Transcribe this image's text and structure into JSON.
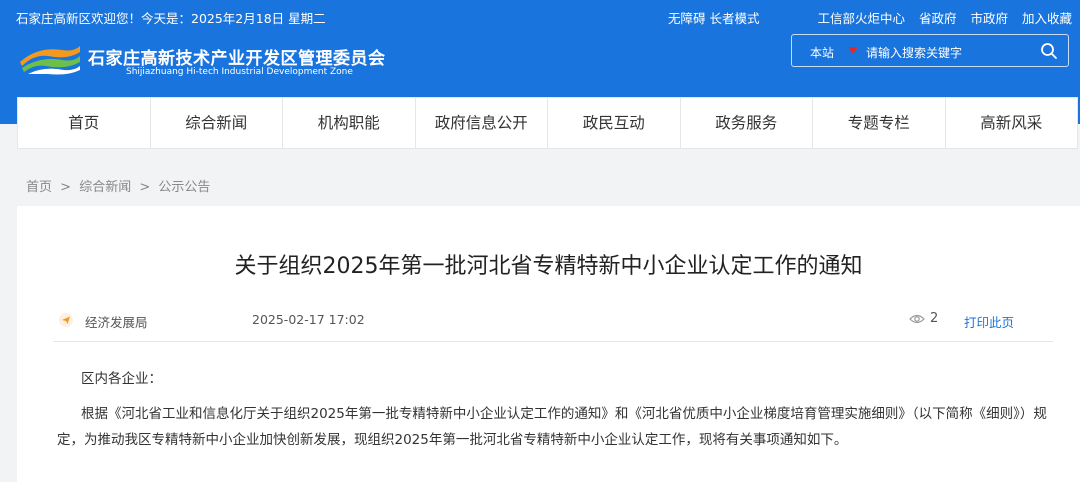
{
  "topbar": {
    "welcome": "石家庄高新区欢迎您！今天是：2025年2月18日 星期二",
    "accessibility": "无障碍 长者模式",
    "links": [
      "工信部火炬中心",
      "省政府",
      "市政府",
      "加入收藏"
    ]
  },
  "site": {
    "name_cn": "石家庄高新技术产业开发区管理委员会",
    "name_en": "Shijiazhuang Hi-tech Industrial Development Zone"
  },
  "search": {
    "scope": "本站",
    "placeholder": "请输入搜索关键字",
    "icon": "search-icon"
  },
  "nav": [
    "首页",
    "综合新闻",
    "机构职能",
    "政府信息公开",
    "政民互动",
    "政务服务",
    "专题专栏",
    "高新风采"
  ],
  "breadcrumb": [
    "首页",
    ">",
    "综合新闻",
    ">",
    "公示公告"
  ],
  "article": {
    "title": "关于组织2025年第一批河北省专精特新中小企业认定工作的通知",
    "source": "经济发展局",
    "date": "2025-02-17 17:02",
    "views": "2",
    "print_label": "打印此页",
    "greeting": "区内各企业：",
    "paragraph": "根据《河北省工业和信息化厅关于组织2025年第一批专精特新中小企业认定工作的通知》和《河北省优质中小企业梯度培育管理实施细则》（以下简称《细则》）规定，为推动我区专精特新中小企业加快创新发展，现组织2025年第一批河北省专精特新中小企业认定工作，现将有关事项通知如下。"
  },
  "colors": {
    "brand_blue": "#1a74dd",
    "caret_red": "#e02a2a",
    "logo_orange": "#f39a1e",
    "logo_green": "#6cc04a"
  }
}
